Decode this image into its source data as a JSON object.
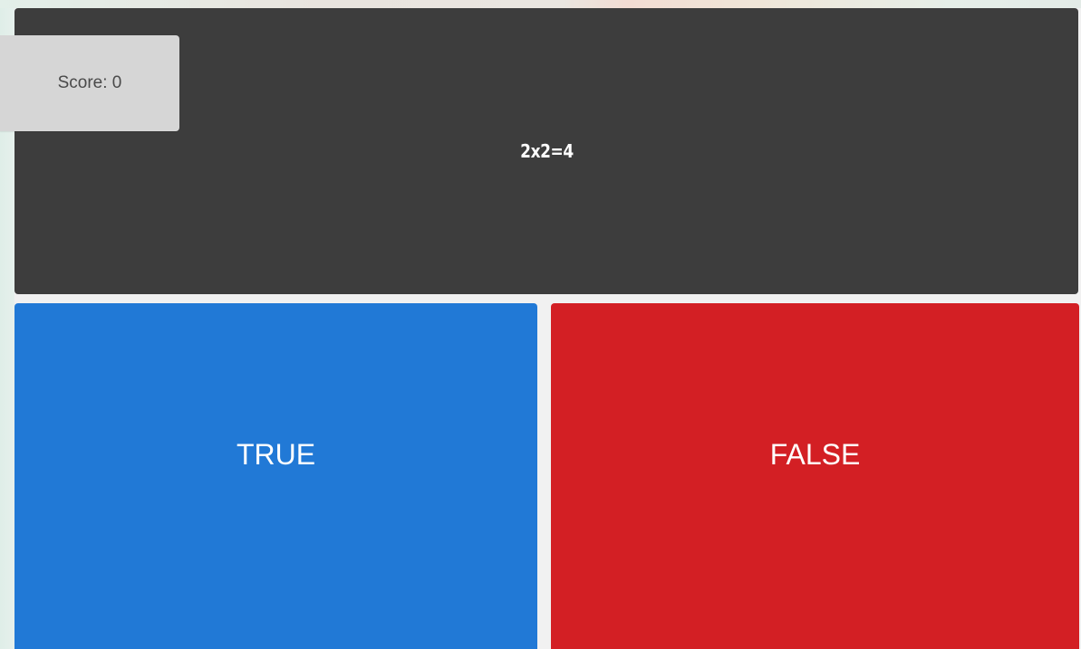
{
  "score": {
    "label": "Score: 0"
  },
  "question": {
    "text": "2x2=4"
  },
  "answers": {
    "true_label": "TRUE",
    "false_label": "FALSE"
  },
  "colors": {
    "question_bg": "#3d3d3d",
    "score_bg": "#d6d6d6",
    "true_bg": "#2179d6",
    "false_bg": "#d31f24"
  }
}
